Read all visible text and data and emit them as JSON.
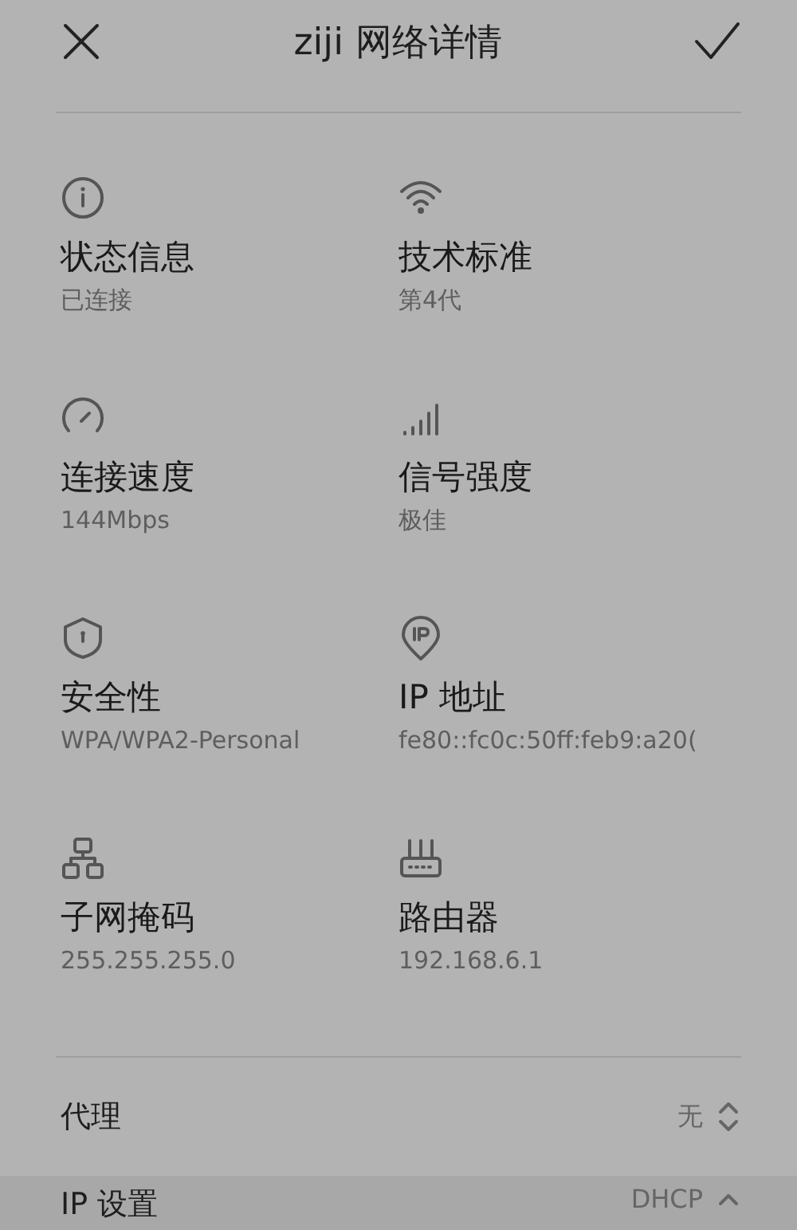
{
  "header": {
    "title": "ziji 网络详情"
  },
  "details": [
    {
      "kind": "info",
      "label": "状态信息",
      "value": "已连接"
    },
    {
      "kind": "wifi",
      "label": "技术标准",
      "value": "第4代"
    },
    {
      "kind": "speed",
      "label": "连接速度",
      "value": "144Mbps"
    },
    {
      "kind": "signal",
      "label": "信号强度",
      "value": "极佳"
    },
    {
      "kind": "shield",
      "label": "安全性",
      "value": "WPA/WPA2-Personal"
    },
    {
      "kind": "ip",
      "label": "IP 地址",
      "value": "fe80::fc0c:50ff:feb9:a20("
    },
    {
      "kind": "subnet",
      "label": "子网掩码",
      "value": "255.255.255.0"
    },
    {
      "kind": "router",
      "label": "路由器",
      "value": "192.168.6.1"
    }
  ],
  "settings": [
    {
      "label": "代理",
      "value": "无",
      "expanded": false
    },
    {
      "label": "IP 设置",
      "value": "DHCP",
      "expanded": true
    }
  ]
}
